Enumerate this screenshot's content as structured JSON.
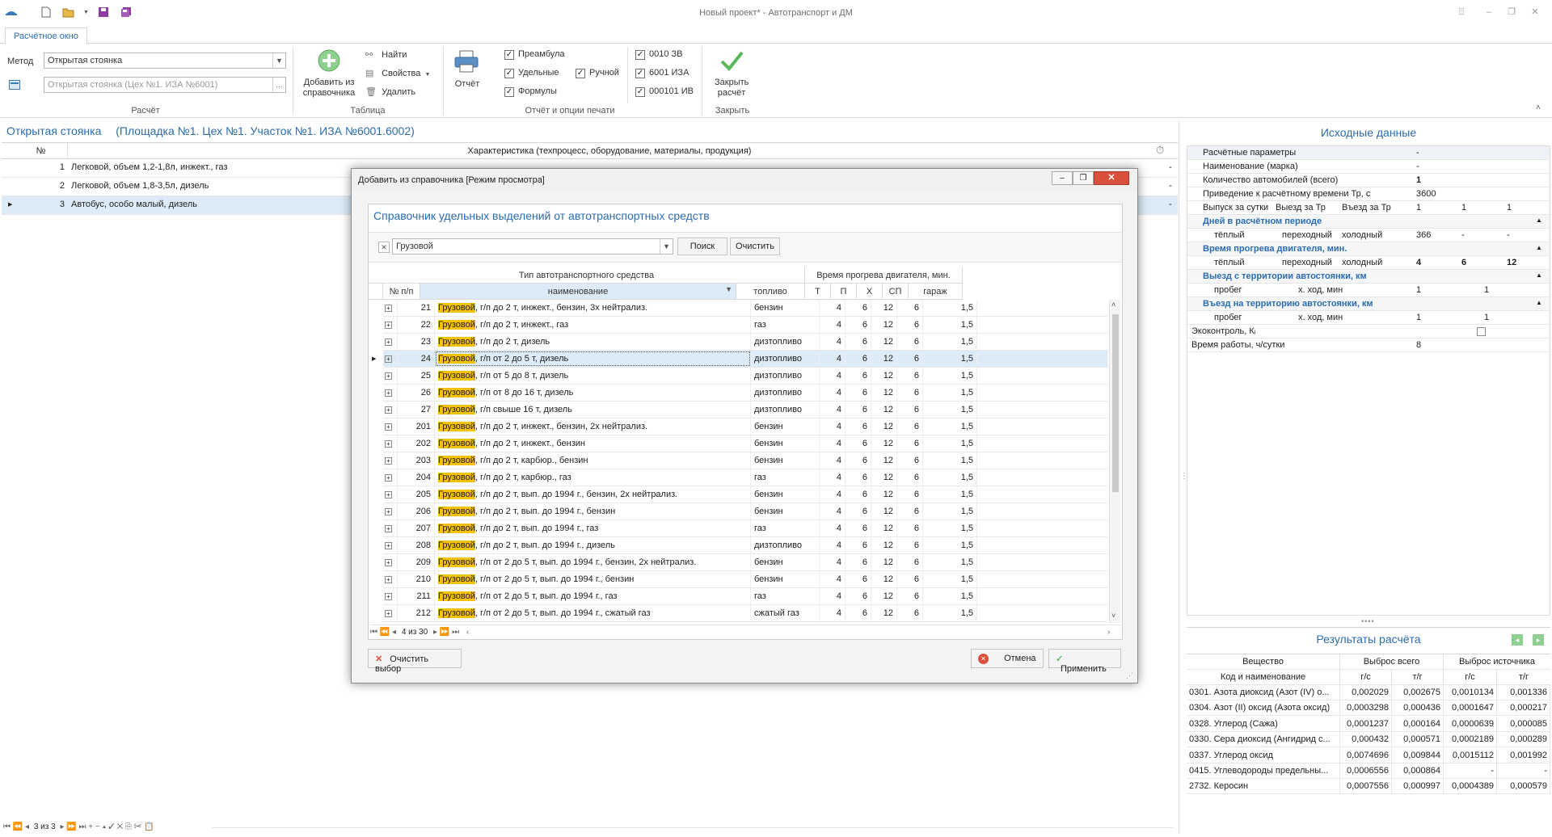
{
  "window": {
    "title": "Новый проект* - Автотранспорт и ДМ"
  },
  "ribbon": {
    "tab_label": "Расчётное окно",
    "method_label": "Метод",
    "method_value": "Открытая стоянка",
    "source_placeholder": "Открытая стоянка (Цех №1. ИЗА №6001)",
    "calc_group": "Расчёт",
    "add_from_ref_label": "Добавить из справочника",
    "find_label": "Найти",
    "properties_label": "Свойства",
    "delete_label": "Удалить",
    "table_group": "Таблица",
    "report_label": "Отчёт",
    "report_group": "Отчёт и опции печати",
    "preamble_label": "Преамбула",
    "specific_label": "Удельные",
    "manual_label": "Ручной",
    "formulas_label": "Формулы",
    "opt_0010": "0010 ЗВ",
    "opt_6001": "6001 ИЗА",
    "opt_000101": "000101 ИВ",
    "close_calc_label": "Закрыть расчёт",
    "close_group": "Закрыть"
  },
  "main": {
    "doc_title": "Открытая стоянка",
    "doc_subtitle": "(Площадка №1. Цех №1. Участок №1. ИЗА №6001.6002)",
    "col_no": "№",
    "col_char": "Характеристика (техпроцесс, оборудование, материалы, продукция)",
    "rows": [
      {
        "no": "1",
        "text": "Легковой, объем 1,2-1,8л, инжект., газ",
        "end": "-"
      },
      {
        "no": "2",
        "text": "Легковой, объем 1,8-3,5л, дизель",
        "end": "-"
      },
      {
        "no": "3",
        "text": "Автобус, особо малый, дизель",
        "end": "-"
      }
    ],
    "nav_text": "3 из 3"
  },
  "right_panel": {
    "title": "Исходные данные",
    "calc_params_label": "Расчётные параметры",
    "calc_params_value": "-",
    "name_label": "Наименование (марка)",
    "name_value": "-",
    "count_label": "Количество автомобилей (всего)",
    "count_value": "1",
    "time_label": "Приведение к расчётному времени Тр, с",
    "time_value": "3600",
    "out_label": "Выпуск за сутки",
    "exit_label": "Выезд за Тр",
    "entry_label": "Въезд за Тр",
    "out_value": "1",
    "exit_value": "1",
    "entry_value": "1",
    "days_cat": "Дней в расчётном периоде",
    "warm": "тёплый",
    "transit": "переходный",
    "cold": "холодный",
    "days_warm": "366",
    "days_transit": "-",
    "days_cold": "-",
    "warmup_cat": "Время прогрева двигателя, мин.",
    "warmup_warm": "4",
    "warmup_transit": "6",
    "warmup_cold": "12",
    "exit_cat": "Выезд с территории автостоянки, км",
    "mileage": "пробег",
    "idle": "х. ход, мин",
    "exit_mileage": "1",
    "exit_idle": "1",
    "entry_cat": "Въезд на территорию автостоянки, км",
    "entry_mileage": "1",
    "entry_idle": "1",
    "eco_label": "Экоконтроль, Кᵢ",
    "work_label": "Время работы, ч/сутки",
    "work_value": "8"
  },
  "results": {
    "title": "Результаты расчёта",
    "col_substance": "Вещество",
    "col_code": "Код и наименование",
    "col_total": "Выброс всего",
    "col_source": "Выброс источника",
    "gs": "г/с",
    "ty": "т/г",
    "rows": [
      {
        "name": "0301. Азота диоксид (Азот (IV) о...",
        "t_gs": "0,002029",
        "t_ty": "0,002675",
        "s_gs": "0,0010134",
        "s_ty": "0,001336"
      },
      {
        "name": "0304. Азот (II) оксид (Азота оксид)",
        "t_gs": "0,0003298",
        "t_ty": "0,000436",
        "s_gs": "0,0001647",
        "s_ty": "0,000217"
      },
      {
        "name": "0328. Углерод (Сажа)",
        "t_gs": "0,0001237",
        "t_ty": "0,000164",
        "s_gs": "0,0000639",
        "s_ty": "0,000085"
      },
      {
        "name": "0330. Сера диоксид (Ангидрид с...",
        "t_gs": "0,000432",
        "t_ty": "0,000571",
        "s_gs": "0,0002189",
        "s_ty": "0,000289"
      },
      {
        "name": "0337. Углерод оксид",
        "t_gs": "0,0074696",
        "t_ty": "0,009844",
        "s_gs": "0,0015112",
        "s_ty": "0,001992"
      },
      {
        "name": "0415. Углеводороды предельны...",
        "t_gs": "0,0006556",
        "t_ty": "0,000864",
        "s_gs": "-",
        "s_ty": "-"
      },
      {
        "name": "2732. Керосин",
        "t_gs": "0,0007556",
        "t_ty": "0,000997",
        "s_gs": "0,0004389",
        "s_ty": "0,000579"
      }
    ]
  },
  "modal": {
    "title": "Добавить из справочника [Режим просмотра]",
    "heading": "Справочник удельных выделений от автотранспортных средств",
    "filter_value": "Грузовой",
    "search_btn": "Поиск",
    "clear_btn": "Очистить",
    "band_type": "Тип автотранспортного средства",
    "band_time": "Время прогрева двигателя, мин.",
    "col_no": "№ п/п",
    "col_name": "наименование",
    "col_fuel": "топливо",
    "col_t": "Т",
    "col_p": "П",
    "col_x": "Х",
    "col_sp": "СП",
    "col_garage": "гараж",
    "highlight": "Грузовой",
    "rows": [
      {
        "no": "21",
        "rest": ", г/п до 2 т, инжект., бензин, 3х нейтрализ.",
        "fuel": "бензин",
        "t": "4",
        "p": "6",
        "x": "12",
        "sp": "6",
        "g": "1,5"
      },
      {
        "no": "22",
        "rest": ", г/п до 2 т, инжект., газ",
        "fuel": "газ",
        "t": "4",
        "p": "6",
        "x": "12",
        "sp": "6",
        "g": "1,5"
      },
      {
        "no": "23",
        "rest": ", г/п до 2 т, дизель",
        "fuel": "дизтопливо",
        "t": "4",
        "p": "6",
        "x": "12",
        "sp": "6",
        "g": "1,5"
      },
      {
        "no": "24",
        "rest": ", г/п от 2 до 5 т, дизель",
        "fuel": "дизтопливо",
        "t": "4",
        "p": "6",
        "x": "12",
        "sp": "6",
        "g": "1,5"
      },
      {
        "no": "25",
        "rest": ", г/п от 5 до 8 т, дизель",
        "fuel": "дизтопливо",
        "t": "4",
        "p": "6",
        "x": "12",
        "sp": "6",
        "g": "1,5"
      },
      {
        "no": "26",
        "rest": ", г/п от 8 до 16 т, дизель",
        "fuel": "дизтопливо",
        "t": "4",
        "p": "6",
        "x": "12",
        "sp": "6",
        "g": "1,5"
      },
      {
        "no": "27",
        "rest": ", г/п свыше 16 т, дизель",
        "fuel": "дизтопливо",
        "t": "4",
        "p": "6",
        "x": "12",
        "sp": "6",
        "g": "1,5"
      },
      {
        "no": "201",
        "rest": ", г/п до 2 т, инжект., бензин, 2х нейтрализ.",
        "fuel": "бензин",
        "t": "4",
        "p": "6",
        "x": "12",
        "sp": "6",
        "g": "1,5"
      },
      {
        "no": "202",
        "rest": ", г/п до 2 т, инжект., бензин",
        "fuel": "бензин",
        "t": "4",
        "p": "6",
        "x": "12",
        "sp": "6",
        "g": "1,5"
      },
      {
        "no": "203",
        "rest": ", г/п до 2 т, карбюр., бензин",
        "fuel": "бензин",
        "t": "4",
        "p": "6",
        "x": "12",
        "sp": "6",
        "g": "1,5"
      },
      {
        "no": "204",
        "rest": ", г/п до 2 т, карбюр., газ",
        "fuel": "газ",
        "t": "4",
        "p": "6",
        "x": "12",
        "sp": "6",
        "g": "1,5"
      },
      {
        "no": "205",
        "rest": ", г/п до 2 т, вып. до 1994 г., бензин, 2х нейтрализ.",
        "fuel": "бензин",
        "t": "4",
        "p": "6",
        "x": "12",
        "sp": "6",
        "g": "1,5"
      },
      {
        "no": "206",
        "rest": ", г/п до 2 т, вып. до 1994 г., бензин",
        "fuel": "бензин",
        "t": "4",
        "p": "6",
        "x": "12",
        "sp": "6",
        "g": "1,5"
      },
      {
        "no": "207",
        "rest": ", г/п до 2 т, вып. до 1994 г., газ",
        "fuel": "газ",
        "t": "4",
        "p": "6",
        "x": "12",
        "sp": "6",
        "g": "1,5"
      },
      {
        "no": "208",
        "rest": ", г/п до 2 т, вып. до 1994 г., дизель",
        "fuel": "дизтопливо",
        "t": "4",
        "p": "6",
        "x": "12",
        "sp": "6",
        "g": "1,5"
      },
      {
        "no": "209",
        "rest": ", г/п от 2 до 5 т, вып. до 1994 г., бензин, 2х нейтрализ.",
        "fuel": "бензин",
        "t": "4",
        "p": "6",
        "x": "12",
        "sp": "6",
        "g": "1,5"
      },
      {
        "no": "210",
        "rest": ", г/п от 2 до 5 т, вып. до 1994 г., бензин",
        "fuel": "бензин",
        "t": "4",
        "p": "6",
        "x": "12",
        "sp": "6",
        "g": "1,5"
      },
      {
        "no": "211",
        "rest": ", г/п от 2 до 5 т, вып. до 1994 г., газ",
        "fuel": "газ",
        "t": "4",
        "p": "6",
        "x": "12",
        "sp": "6",
        "g": "1,5"
      },
      {
        "no": "212",
        "rest": ", г/п от 2 до 5 т, вып. до 1994 г., сжатый газ",
        "fuel": "сжатый газ",
        "t": "4",
        "p": "6",
        "x": "12",
        "sp": "6",
        "g": "1,5"
      }
    ],
    "nav_text": "4 из 30",
    "clear_selection_btn": "Очистить выбор",
    "cancel_btn": "Отмена",
    "apply_btn": "Применить"
  },
  "colors": {
    "accent": "#2b6cb0",
    "highlight": "#f6c200",
    "selected_row": "#dcebf7"
  }
}
